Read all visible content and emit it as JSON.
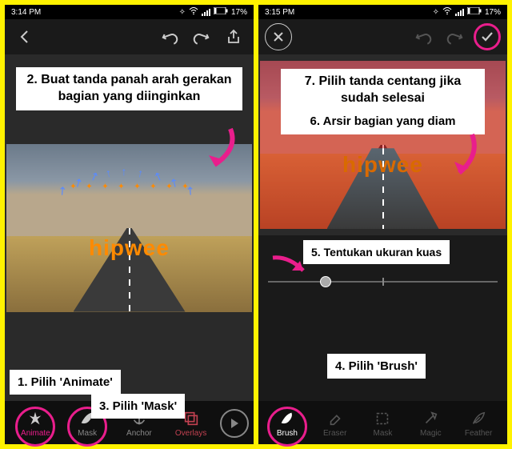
{
  "left": {
    "time": "3:14 PM",
    "battery": "17%",
    "callouts": {
      "c2": "2. Buat tanda panah arah gerakan bagian yang diinginkan",
      "c1": "1. Pilih 'Animate'",
      "c3": "3. Pilih 'Mask'"
    },
    "tabs": {
      "animate": "Animate",
      "mask": "Mask",
      "anchor": "Anchor",
      "overlays": "Overlays"
    },
    "watermark": "hipwee"
  },
  "right": {
    "time": "3:15 PM",
    "battery": "17%",
    "callouts": {
      "c7": "7. Pilih tanda centang jika sudah selesai",
      "c6": "6. Arsir bagian yang diam",
      "c5": "5. Tentukan ukuran kuas",
      "c4": "4. Pilih 'Brush'"
    },
    "tabs": {
      "brush": "Brush",
      "eraser": "Eraser",
      "mask": "Mask",
      "magic": "Magic",
      "feather": "Feather"
    },
    "watermark": "hipwee"
  }
}
